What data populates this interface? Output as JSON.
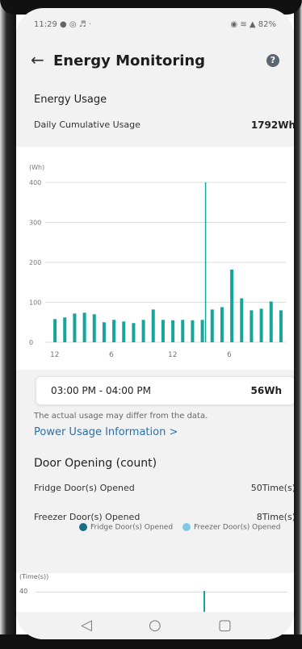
{
  "status": {
    "time": "11:29",
    "icons_left": "● ◎ ♬ ·",
    "battery": "82%",
    "icons_right": "◉ ≋ ▲"
  },
  "header": {
    "title": "Energy Monitoring",
    "back_icon": "arrow-left-icon",
    "help_icon": "help-icon",
    "help_glyph": "?"
  },
  "energy": {
    "section_title": "Energy Usage",
    "daily_label": "Daily Cumulative Usage",
    "daily_value": "1792Wh"
  },
  "chart_data": {
    "type": "bar",
    "ylabel": "(Wh)",
    "ylim": [
      0,
      400
    ],
    "yticks": [
      "400",
      "300",
      "200",
      "100",
      "0"
    ],
    "xticks": [
      "12",
      "6",
      "12",
      "6"
    ],
    "values": [
      58,
      62,
      72,
      74,
      70,
      50,
      56,
      52,
      48,
      56,
      82,
      56,
      55,
      56,
      55,
      56,
      82,
      88,
      182,
      110,
      80,
      84,
      102,
      80
    ],
    "highlight_index": 15,
    "highlight_value": 56,
    "colors": {
      "bar": "#16a59a",
      "grid": "#dcdcdc",
      "marker": "#16a59a"
    }
  },
  "tooltip": {
    "time": "03:00 PM - 04:00 PM",
    "value": "56Wh"
  },
  "note": "The actual usage may differ from the data.",
  "link": {
    "label": "Power Usage Information >"
  },
  "door": {
    "title": "Door Opening (count)",
    "fridge_label": "Fridge Door(s) Opened",
    "fridge_value": "50Time(s)",
    "freezer_label": "Freezer Door(s) Opened",
    "freezer_value": "8Time(s)",
    "legend_fridge": "Fridge Door(s) Opened",
    "legend_freezer": "Freezer Door(s) Opened",
    "colors": {
      "fridge": "#1b6e86",
      "freezer": "#7ec8e8"
    }
  },
  "chart2": {
    "ylabel": "(Time(s))",
    "ytick_top": "40"
  },
  "nav": {
    "back": "◁",
    "home": "○",
    "recent": "▢"
  }
}
